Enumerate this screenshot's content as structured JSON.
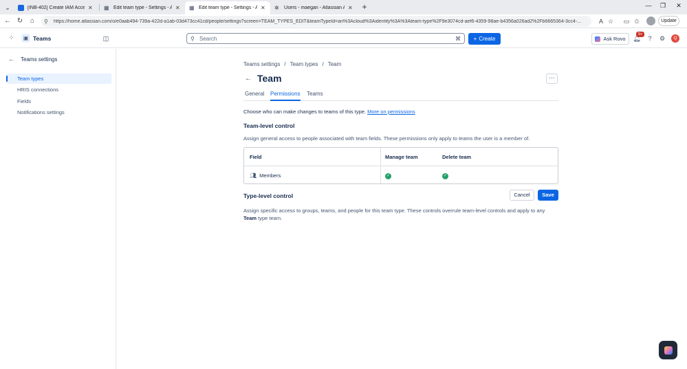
{
  "browser": {
    "tabs": [
      {
        "title": "[INB-402] Create IAM Accesskey -",
        "favicon_color": "#1868db"
      },
      {
        "title": "Edit team type - Settings - Atlassi",
        "favicon_color": "#44546f"
      },
      {
        "title": "Edit team type - Settings - Atlassia",
        "favicon_color": "#44546f"
      },
      {
        "title": "Users - maegan - Atlassian Admini",
        "favicon_color": "#333333"
      }
    ],
    "url": "https://home.atlassian.com/o/e0aab494-739a-422d-a1ab-03d473cc41cd/people/settings?screen=TEAM_TYPES_EDIT&teamTypeId=ari%3Acloud%3Aidentity%3A%3Ateam-type%2F9e3074cd-aef6-4359-98ae-b4356a026ad2%2Fb6665364-3cc4-...",
    "update_label": "Update",
    "icons": {
      "back": "back-arrow-icon",
      "refresh": "refresh-icon",
      "home": "home-icon"
    }
  },
  "header": {
    "app_name": "Teams",
    "search_placeholder": "Search",
    "create_label": "Create",
    "rovo_label": "Ask Rovo",
    "notification_count": "9+",
    "avatar_initial": "Q",
    "accent": "#0c66e4"
  },
  "sidebar": {
    "title": "Teams settings",
    "items": [
      {
        "label": "Team types",
        "selected": true
      },
      {
        "label": "HRIS connections",
        "selected": false
      },
      {
        "label": "Fields",
        "selected": false
      },
      {
        "label": "Notifications settings",
        "selected": false
      }
    ]
  },
  "main": {
    "breadcrumbs": [
      "Teams settings",
      "/",
      "Team types",
      "/",
      "Team"
    ],
    "title": "Team",
    "tabs": [
      {
        "label": "General",
        "active": false
      },
      {
        "label": "Permissions",
        "active": true
      },
      {
        "label": "Teams",
        "active": false
      }
    ],
    "intro_text": "Choose who can make changes to teams of this type.",
    "intro_link": "More on permissions",
    "team_level": {
      "heading": "Team-level control",
      "description": "Assign general access to people associated with team fields. These permissions only apply to teams the user is a member of.",
      "columns": [
        "Field",
        "Manage team",
        "Delete team"
      ],
      "rows": [
        {
          "field": "Members",
          "manage_team": true,
          "delete_team": true
        }
      ]
    },
    "type_level": {
      "heading": "Type-level control",
      "description_part1": "Assign specific access to groups, teams, and people for this team type. These controls overrule team-level controls and apply to any",
      "description_bold": "Team",
      "description_part2": "type team."
    },
    "cancel_label": "Cancel",
    "save_label": "Save",
    "success_color": "#22a06b"
  }
}
